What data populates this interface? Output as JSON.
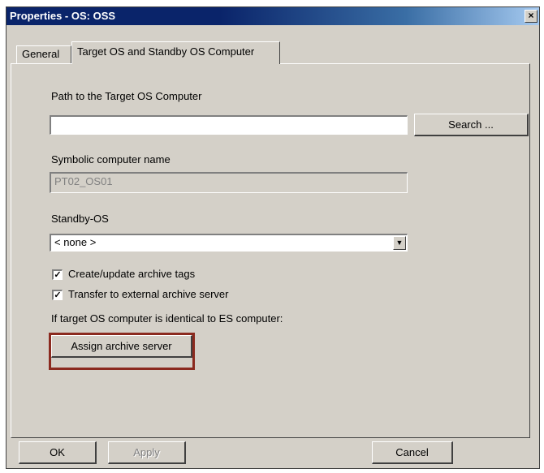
{
  "window": {
    "title": "Properties - OS: OSS",
    "close_glyph": "×"
  },
  "tabs": [
    {
      "label": "General",
      "active": false
    },
    {
      "label": "Target OS and Standby OS Computer",
      "active": true
    }
  ],
  "form": {
    "path_label": "Path to the Target OS Computer",
    "path_value": "",
    "search_label": "Search ...",
    "symbolic_label": "Symbolic computer name",
    "symbolic_value": "PT02_OS01",
    "standby_label": "Standby-OS",
    "standby_value": "< none >",
    "dropdown_glyph": "▼",
    "check_glyph": "✓",
    "checkboxes": [
      {
        "label": "Create/update archive tags",
        "checked": true
      },
      {
        "label": "Transfer to external archive server",
        "checked": true
      }
    ],
    "info_text": "If target OS computer is identical to ES computer:",
    "assign_label": "Assign archive server"
  },
  "footer": {
    "ok_label": "OK",
    "apply_label": "Apply",
    "cancel_label": "Cancel"
  },
  "colors": {
    "highlight": "#8b2a1f",
    "titlebar": "#0a246a"
  }
}
